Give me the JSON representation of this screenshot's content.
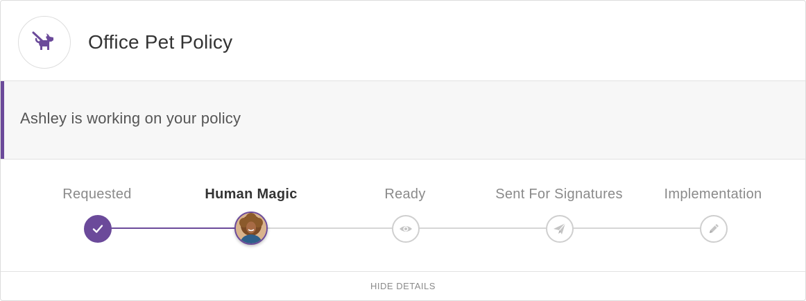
{
  "header": {
    "title": "Office Pet Policy",
    "icon": "dog-on-leash-icon",
    "accent_color": "#6b4a9a"
  },
  "banner": {
    "message": "Ashley is working on your policy"
  },
  "steps": [
    {
      "label": "Requested",
      "state": "done",
      "icon": "check-icon"
    },
    {
      "label": "Human Magic",
      "state": "current",
      "icon": "avatar"
    },
    {
      "label": "Ready",
      "state": "pending",
      "icon": "eye-icon"
    },
    {
      "label": "Sent For Signatures",
      "state": "pending",
      "icon": "paper-plane-icon"
    },
    {
      "label": "Implementation",
      "state": "pending",
      "icon": "pencil-icon"
    }
  ],
  "footer": {
    "toggle_label": "HIDE DETAILS"
  }
}
